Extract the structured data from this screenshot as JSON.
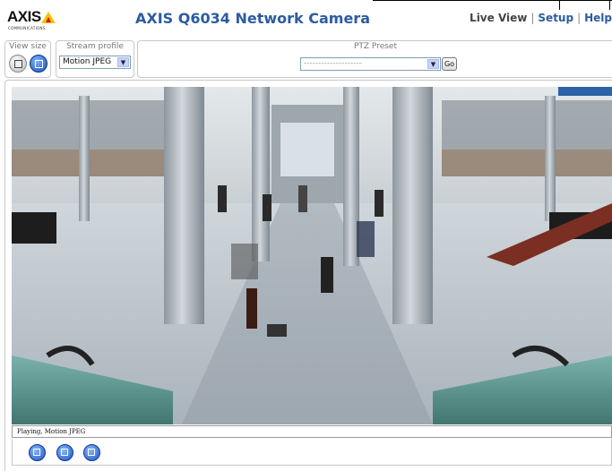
{
  "header": {
    "logo_text": "AXIS",
    "logo_subtext": "COMMUNICATIONS",
    "title": "AXIS Q6034 Network Camera",
    "nav": {
      "live_view": "Live View",
      "setup": "Setup",
      "help": "Help",
      "separator": "|"
    }
  },
  "controls": {
    "view_size": {
      "label": "View size"
    },
    "stream_profile": {
      "label": "Stream profile",
      "selected": "Motion JPEG"
    },
    "ptz_preset": {
      "label": "PTZ Preset",
      "selected": "--------------------",
      "go_label": "Go"
    }
  },
  "status": {
    "text": "Playing, Motion JPEG"
  },
  "bottom_controls": {
    "icons": [
      "stop-icon",
      "snapshot-icon",
      "fullscreen-icon"
    ]
  },
  "colors": {
    "title": "#2c5c9e",
    "link": "#2c5c9e",
    "logo_triangle": "#f5c400",
    "button_blue": "#1b53bf"
  }
}
